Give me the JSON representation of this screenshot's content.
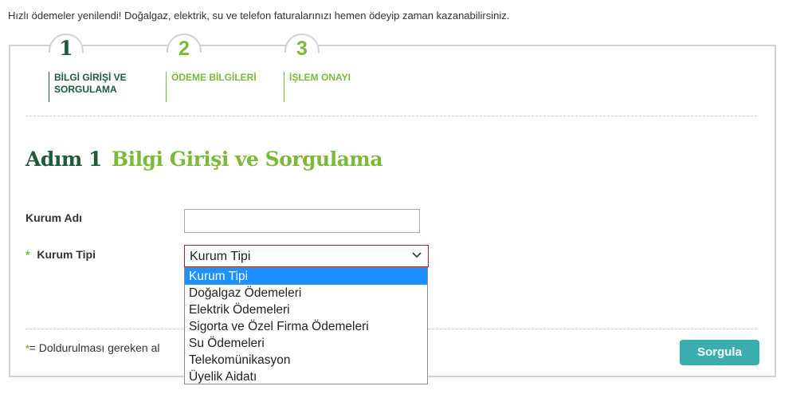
{
  "announcement": "Hızlı ödemeler yenilendi! Doğalgaz, elektrik, su ve telefon faturalarınızı hemen ödeyip zaman kazanabilirsiniz.",
  "steps": [
    {
      "number": "1",
      "label_line1": "BİLGİ GİRİŞİ VE",
      "label_line2": "SORGULAMA",
      "state": "active"
    },
    {
      "number": "2",
      "label_line1": "ÖDEME BİLGİLERİ",
      "label_line2": "",
      "state": "inactive"
    },
    {
      "number": "3",
      "label_line1": "İŞLEM ONAYI",
      "label_line2": "",
      "state": "inactive"
    }
  ],
  "heading": {
    "step_part": "Adım 1",
    "title_part": "Bilgi Girişi ve Sorgulama"
  },
  "form": {
    "institution_name_label": "Kurum Adı",
    "institution_name_value": "",
    "required_marker": "*",
    "institution_type_label": "Kurum Tipi",
    "institution_type_selected": "Kurum Tipi",
    "institution_type_options": [
      "Kurum Tipi",
      "Doğalgaz Ödemeleri",
      "Elektrik Ödemeleri",
      "Sigorta ve Özel Firma Ödemeleri",
      "Su Ödemeleri",
      "Telekomünikasyon",
      "Üyelik Aidatı"
    ]
  },
  "required_note": "= Doldurulması gereken al",
  "query_button": "Sorgula",
  "colors": {
    "dark_green": "#1e5a3c",
    "light_green": "#7cb83a",
    "button_teal": "#3aaeae",
    "select_border_red": "#b51f24",
    "option_highlight": "#1e90ff"
  }
}
